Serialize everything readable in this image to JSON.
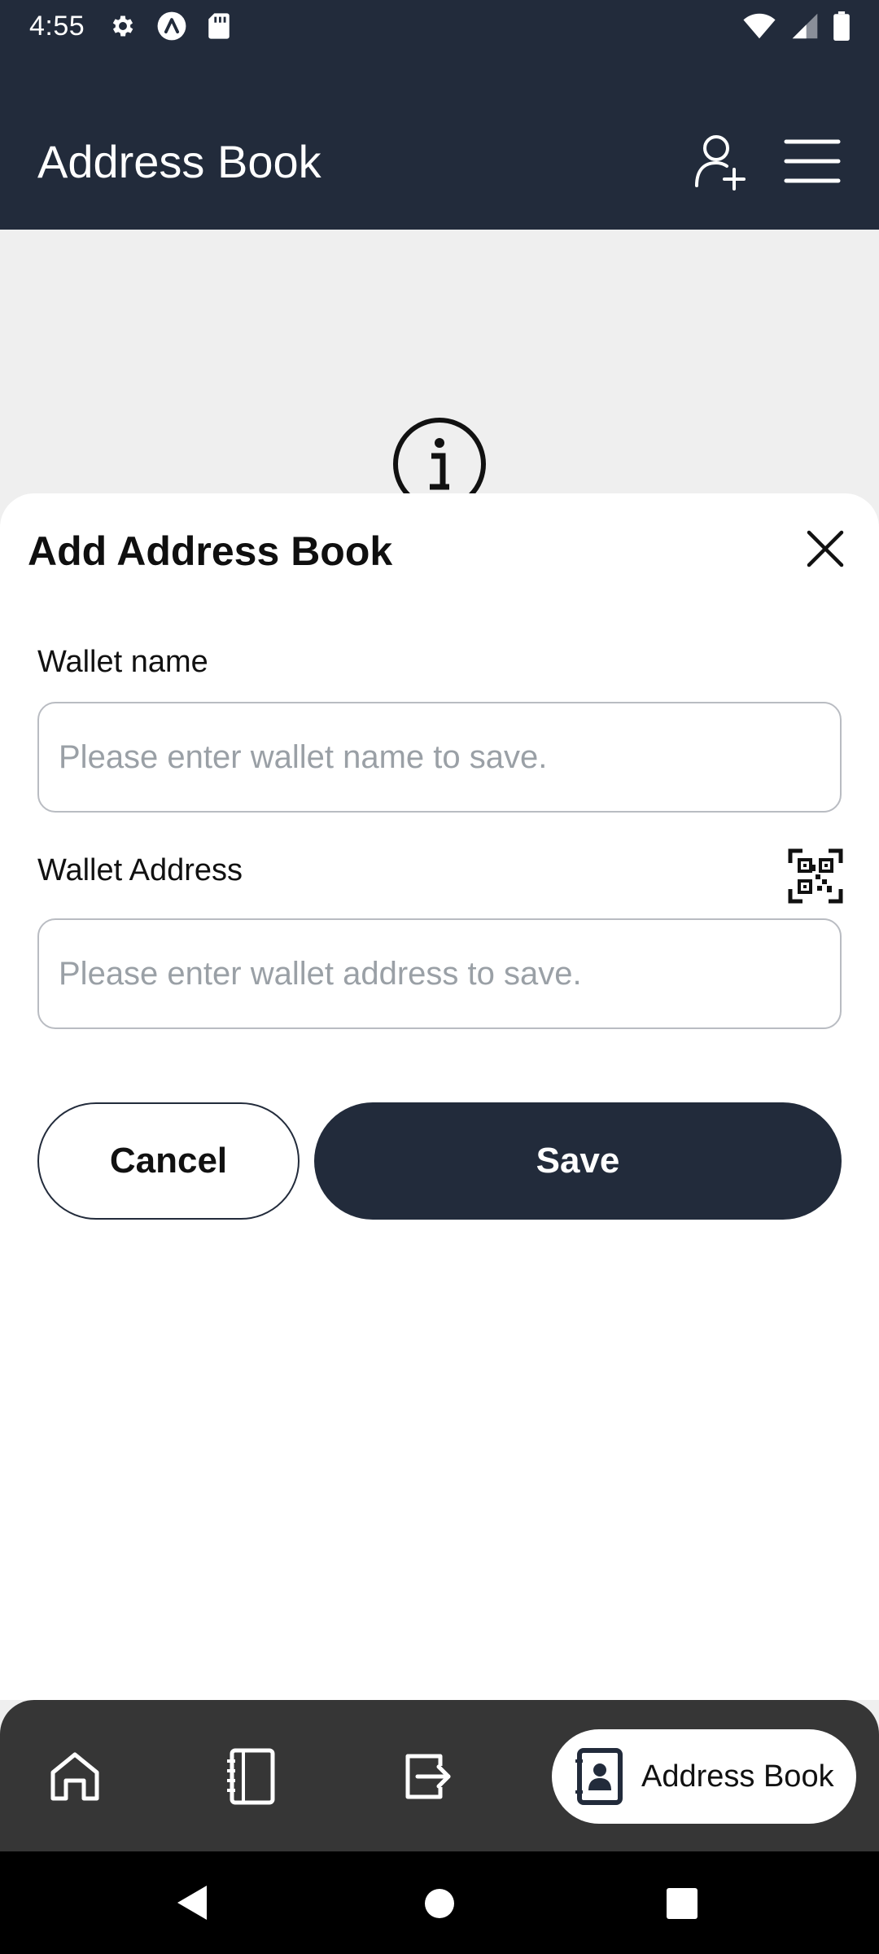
{
  "status_bar": {
    "time": "4:55",
    "icons_left": [
      "settings-icon",
      "app-notification-icon",
      "sd-card-icon"
    ],
    "icons_right": [
      "wifi-icon",
      "signal-icon",
      "battery-icon"
    ]
  },
  "app_bar": {
    "title": "Address Book",
    "actions": [
      "add-user-icon",
      "menu-icon"
    ]
  },
  "sheet": {
    "title": "Add Address Book",
    "wallet_name": {
      "label": "Wallet name",
      "value": "",
      "placeholder": "Please enter wallet name to save."
    },
    "wallet_address": {
      "label": "Wallet Address",
      "value": "",
      "placeholder": "Please enter wallet address to save."
    },
    "cancel_label": "Cancel",
    "save_label": "Save"
  },
  "bottom_nav": {
    "items": [
      {
        "icon": "home-icon"
      },
      {
        "icon": "notebook-icon"
      },
      {
        "icon": "transfer-icon"
      },
      {
        "icon": "address-book-icon",
        "label": "Address Book",
        "active": true
      }
    ]
  },
  "colors": {
    "primary": "#222b3b",
    "sheet_bg": "#ffffff",
    "nav_bg": "#363636",
    "placeholder": "#9aa0a6"
  }
}
